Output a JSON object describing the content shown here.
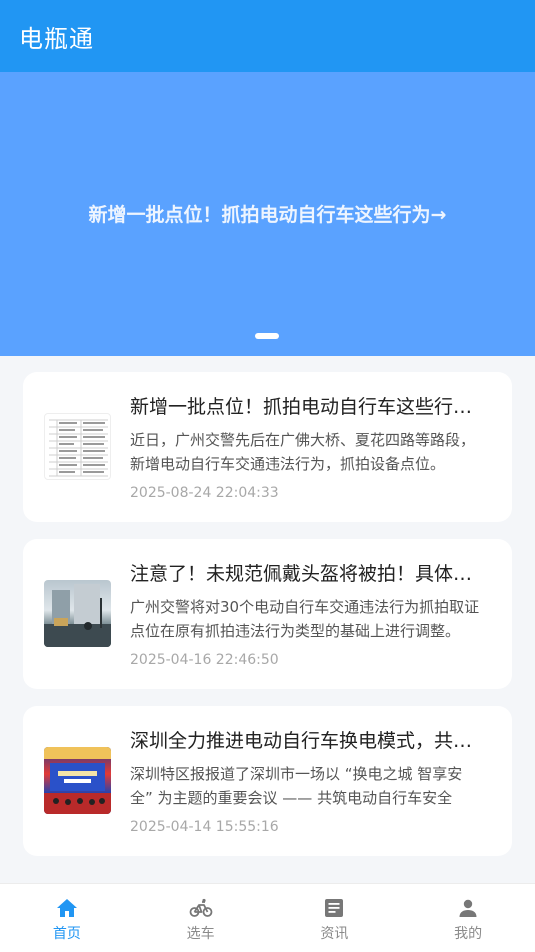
{
  "app": {
    "title": "电瓶通"
  },
  "banner": {
    "text": "新增一批点位！抓拍电动自行车这些行为→"
  },
  "news": [
    {
      "headline": "新增一批点位！抓拍电动自行车这些行为→",
      "summary": "近日，广州交警先后在广佛大桥、夏花四路等路段，新增电动自行车交通违法行为，抓拍设备点位。",
      "time": "2025-08-24 22:04:33"
    },
    {
      "headline": "注意了！未规范佩戴头盔将被拍！具体点位→",
      "summary": "广州交警将对30个电动自行车交通违法行为抓拍取证点位在原有抓拍违法行为类型的基础上进行调整。",
      "time": "2025-04-16 22:46:50"
    },
    {
      "headline": "深圳全力推进电动自行车换电模式，共筑安全",
      "summary": "深圳特区报报道了深圳市一场以 “换电之城 智享安全” 为主题的重要会议 —— 共筑电动自行车安全",
      "time": "2025-04-14 15:55:16"
    }
  ],
  "tabs": [
    {
      "label": "首页",
      "icon": "home-icon"
    },
    {
      "label": "选车",
      "icon": "bicycle-icon"
    },
    {
      "label": "资讯",
      "icon": "news-icon"
    },
    {
      "label": "我的",
      "icon": "user-icon"
    }
  ],
  "colors": {
    "primary": "#2196f3",
    "banner": "#5aa2ff"
  }
}
